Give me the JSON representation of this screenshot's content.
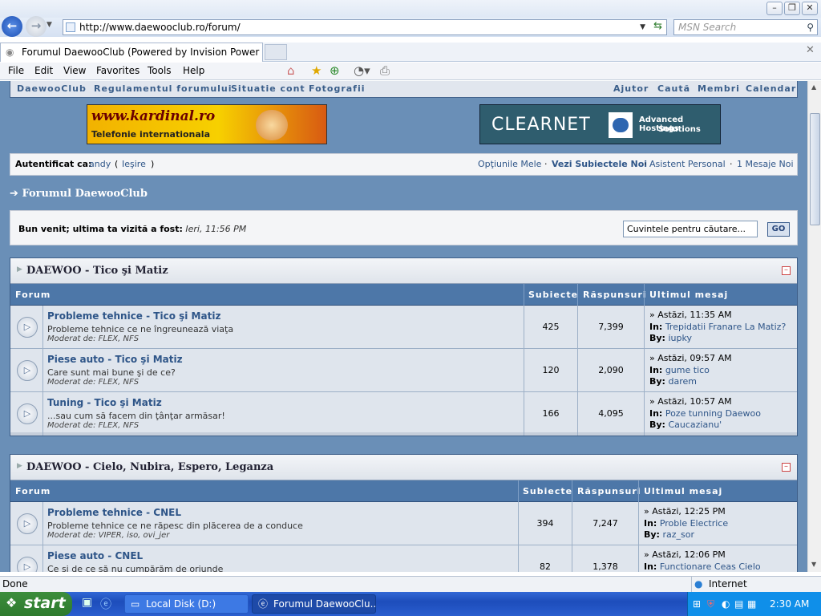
{
  "browser": {
    "address": "http://www.daewooclub.ro/forum/",
    "search_placeholder": "MSN Search",
    "tab_title": "Forumul DaewooClub (Powered by Invision Power Boar",
    "menu": [
      "File",
      "Edit",
      "View",
      "Favorites",
      "Tools",
      "Help"
    ],
    "status": "Done",
    "zone": "Internet"
  },
  "topnav": {
    "left": [
      "DaewooClub",
      "Regulamentul forumului",
      "Situatie cont",
      "Fotografii"
    ],
    "right": [
      "Ajutor",
      "Caută",
      "Membri",
      "Calendar"
    ]
  },
  "banners": {
    "left_title": "www.kardinal.ro",
    "left_sub": "Telefonie internationala",
    "right_title": "CLEARNET",
    "right_sub1": "Advanced Hostings",
    "right_sub2": "Solutions"
  },
  "userbar": {
    "label": "Autentificat ca:",
    "user": "andy",
    "logout": "Ieşire",
    "links": [
      "Opţiunile Mele",
      "Vezi Subiectele Noi",
      "Asistent Personal",
      "1 Mesaje Noi"
    ]
  },
  "navstrip": "Forumul DaewooClub",
  "welcome": {
    "text": "Bun venit; ultima ta vizită a fost:",
    "last_visit": "Ieri, 11:56 PM",
    "search_placeholder": "Cuvintele pentru căutare...",
    "go": "GO"
  },
  "columns": [
    "Forum",
    "Subiecte",
    "Răspunsuri",
    "Ultimul mesaj"
  ],
  "categories": [
    {
      "title": "DAEWOO - Tico şi Matiz",
      "forums": [
        {
          "title": "Probleme tehnice - Tico şi Matiz",
          "desc": "Probleme tehnice ce ne îngreunează viaţa",
          "mod": "Moderat de: FLEX, NFS",
          "topics": "425",
          "replies": "7,399",
          "last_time": "Astăzi, 11:35 AM",
          "last_in": "Trepidatii Franare La Matiz?",
          "last_by": "iupky"
        },
        {
          "title": "Piese auto - Tico şi Matiz",
          "desc": "Care sunt mai bune şi de ce?",
          "mod": "Moderat de: FLEX, NFS",
          "topics": "120",
          "replies": "2,090",
          "last_time": "Astăzi, 09:57 AM",
          "last_in": "gume tico",
          "last_by": "darem"
        },
        {
          "title": "Tuning - Tico şi Matiz",
          "desc": "...sau cum să facem din ţânţar armăsar!",
          "mod": "Moderat de: FLEX, NFS",
          "topics": "166",
          "replies": "4,095",
          "last_time": "Astăzi, 10:57 AM",
          "last_in": "Poze tunning Daewoo",
          "last_by": "Caucazianu'"
        }
      ]
    },
    {
      "title": "DAEWOO - Cielo, Nubira, Espero, Leganza",
      "forums": [
        {
          "title": "Probleme tehnice - CNEL",
          "desc": "Probleme tehnice ce ne răpesc din plăcerea de a conduce",
          "mod": "Moderat de: VIPER, iso, ovi_jer",
          "topics": "394",
          "replies": "7,247",
          "last_time": "Astăzi, 12:25 PM",
          "last_in": "Proble Electrice",
          "last_by": "raz_sor"
        },
        {
          "title": "Piese auto - CNEL",
          "desc": "Ce şi de ce să nu cumpărăm de oriunde",
          "mod": "",
          "topics": "82",
          "replies": "1,378",
          "last_time": "Astăzi, 12:06 PM",
          "last_in": "Functionare Ceas Cielo",
          "last_by": ""
        }
      ]
    }
  ],
  "labels": {
    "in": "In:",
    "by": "By:"
  },
  "taskbar": {
    "start": "start",
    "items": [
      "Local Disk (D:)",
      "Forumul DaewooClu..."
    ],
    "clock": "2:30 AM"
  }
}
